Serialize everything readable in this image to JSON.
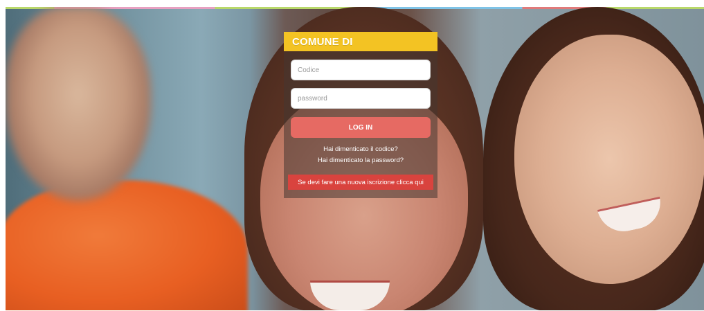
{
  "login": {
    "title": "COMUNE DI",
    "code_placeholder": "Codice",
    "code_value": "",
    "password_placeholder": "password",
    "password_value": "",
    "login_label": "LOG IN",
    "forgot_code": "Hai dimenticato il codice?",
    "forgot_password": "Hai dimenticato la password?",
    "signup_label": "Se devi fare una nuova iscrizione clicca qui"
  },
  "colors": {
    "header_accent": "#f3c323",
    "login_button": "#e66a63",
    "signup_button": "#d9433e"
  }
}
